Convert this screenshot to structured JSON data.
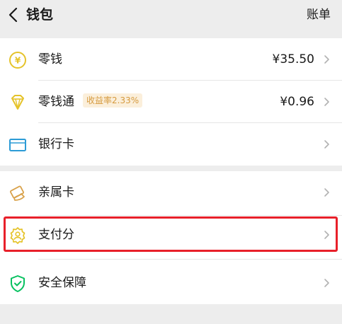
{
  "header": {
    "title": "钱包",
    "bill_label": "账单"
  },
  "items": [
    {
      "label": "零钱",
      "value": "¥35.50",
      "icon": "yuan-coin-icon"
    },
    {
      "label": "零钱通",
      "value": "¥0.96",
      "badge": "收益率2.33%",
      "icon": "diamond-icon"
    },
    {
      "label": "银行卡",
      "icon": "bank-card-icon"
    },
    {
      "label": "亲属卡",
      "icon": "family-card-icon"
    },
    {
      "label": "支付分",
      "icon": "pay-score-icon"
    },
    {
      "label": "安全保障",
      "icon": "shield-icon"
    }
  ],
  "colors": {
    "background": "#ededed",
    "card": "#ffffff",
    "gold_icon": "#e5c32a",
    "badge_bg": "#fbefdb",
    "badge_text": "#d69a3e",
    "blue_icon": "#2c9bd6",
    "green_icon": "#07c160",
    "highlight": "#e8202a"
  }
}
